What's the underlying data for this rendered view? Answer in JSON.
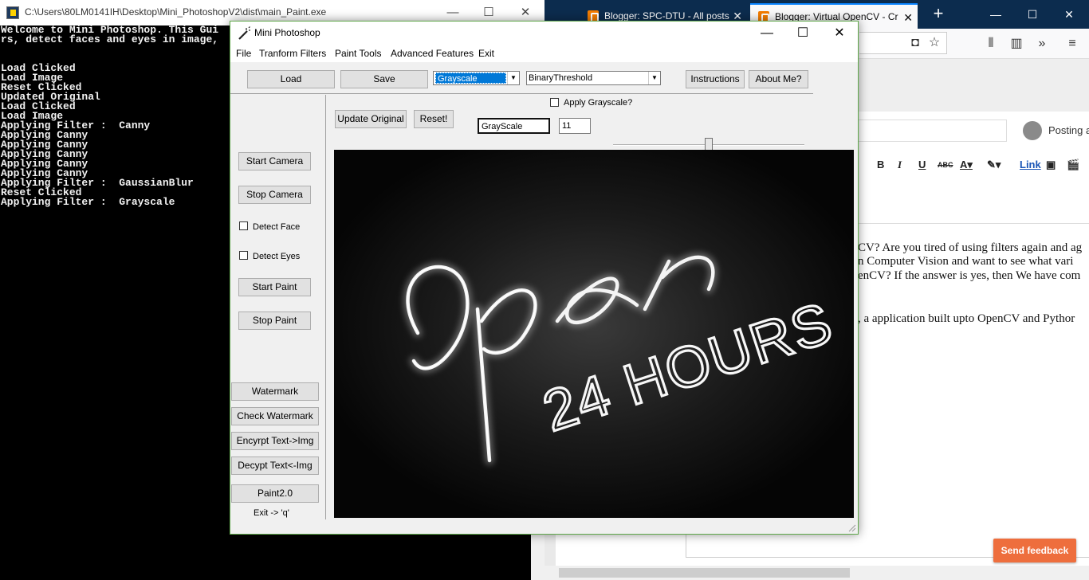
{
  "browser": {
    "tabs": [
      {
        "title": "Blogger: SPC-DTU - All posts",
        "active": false
      },
      {
        "title": "Blogger: Virtual OpenCV - Cr",
        "active": true
      }
    ],
    "new_tab_glyph": "+",
    "window_controls": {
      "minimize": "—",
      "maximize": "☐",
      "close": "✕"
    },
    "posting_label": "Posting a",
    "editor_toolbar": {
      "bold": "B",
      "italic": "I",
      "underline": "U",
      "strike": "ABC",
      "link": "Link"
    },
    "post_lines": [
      "CV? Are you tired of using filters again and ag",
      "n Computer Vision and want to see what vari",
      "enCV? If the answer is yes, then We have com",
      ", a application built upto OpenCV and Pythor"
    ],
    "feedback_button": "Send feedback"
  },
  "console": {
    "title": "C:\\Users\\80LM0141IH\\Desktop\\Mini_PhotoshopV2\\dist\\main_Paint.exe",
    "window_controls": {
      "minimize": "—",
      "maximize": "☐",
      "close": "✕"
    },
    "lines": [
      "Welcome to Mini Photoshop. This Gui",
      "rs, detect faces and eyes in image,",
      "",
      "",
      "Load Clicked",
      "Load Image",
      "Reset Clicked",
      "Updated Original",
      "Load Clicked",
      "Load Image",
      "Applying Filter :  Canny",
      "Applying Canny",
      "Applying Canny",
      "Applying Canny",
      "Applying Canny",
      "Applying Canny",
      "Applying Filter :  GaussianBlur",
      "Reset Clicked",
      "Applying Filter :  Grayscale"
    ]
  },
  "app": {
    "title": "Mini Photoshop",
    "window_controls": {
      "minimize": "—",
      "maximize": "☐",
      "close": "✕"
    },
    "menu": [
      "File",
      "Tranform Filters",
      "Paint Tools",
      "Advanced Features",
      "Exit"
    ],
    "toolbar": {
      "load": "Load",
      "save": "Save",
      "filter_select": "Grayscale",
      "threshold_select": "BinaryThreshold",
      "instructions": "Instructions",
      "about": "About Me?"
    },
    "controls": {
      "apply_grayscale_label": "Apply Grayscale?",
      "apply_grayscale_checked": false,
      "update_original": "Update Original",
      "reset": "Reset!",
      "filter_name_value": "GrayScale",
      "param_value": "11",
      "slider_level": 0.5
    },
    "sidebar": {
      "start_camera": "Start Camera",
      "stop_camera": "Stop Camera",
      "detect_face": "Detect Face",
      "detect_face_checked": false,
      "detect_eyes": "Detect Eyes",
      "detect_eyes_checked": false,
      "start_paint": "Start Paint",
      "stop_paint": "Stop Paint",
      "watermark": "Watermark",
      "check_watermark": "Check Watermark",
      "encrypt": "Encyrpt Text->Img",
      "decrypt": "Decypt Text<-Img",
      "paint2": "Paint2.0",
      "exit_hint": "Exit -> 'q'"
    },
    "preview": {
      "text_script": "Open",
      "text_hours": "24 HOURS"
    }
  }
}
